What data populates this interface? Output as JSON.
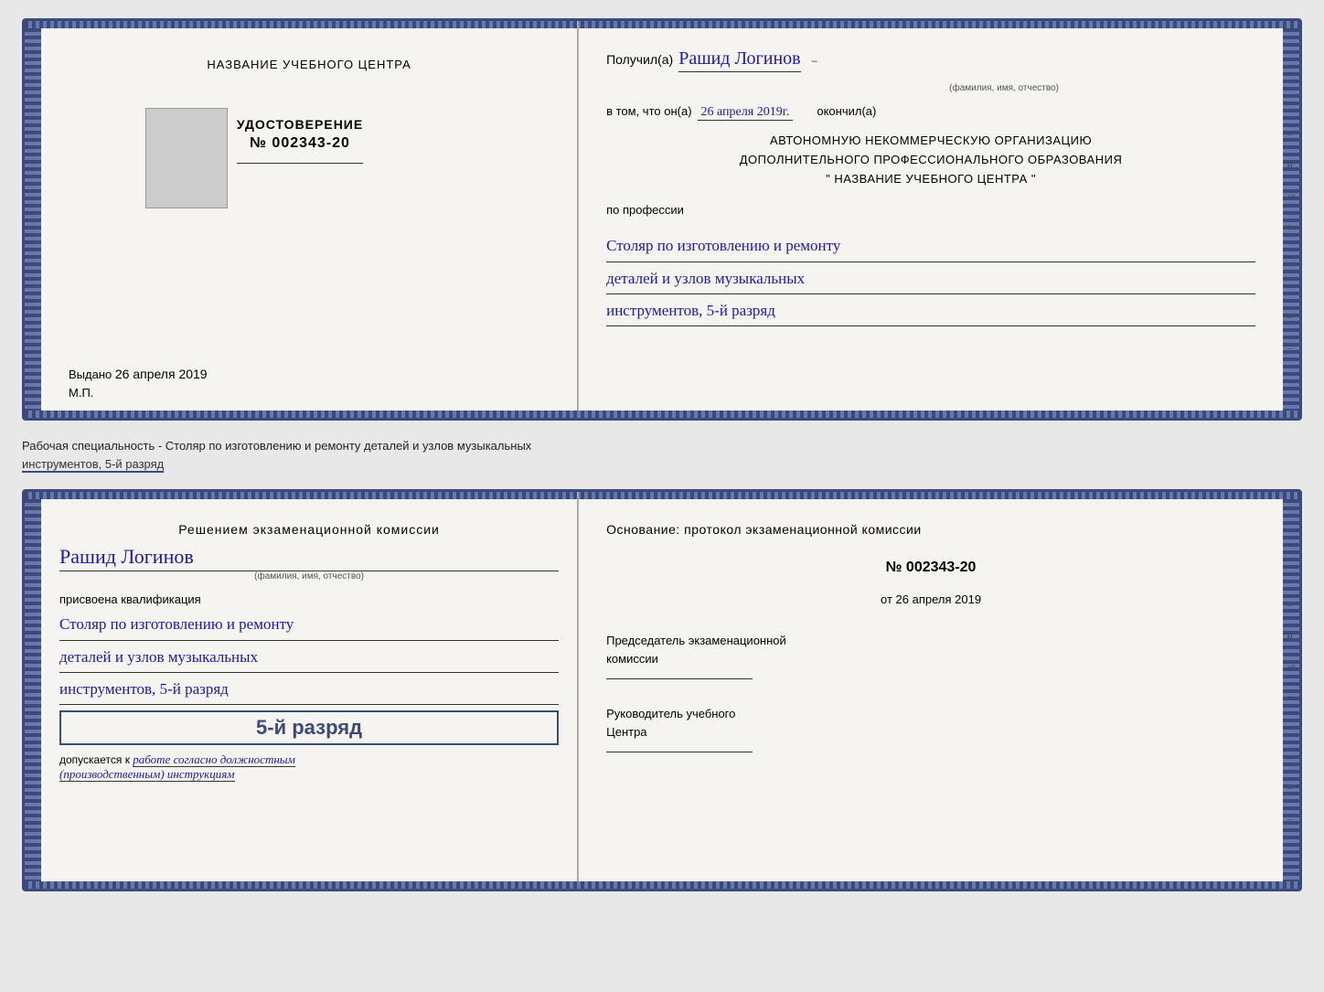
{
  "topDoc": {
    "leftPanel": {
      "centerTitle": "НАЗВАНИЕ УЧЕБНОГО ЦЕНТРА",
      "udostLabel": "УДОСТОВЕРЕНИЕ",
      "udostNum": "№ 002343-20",
      "vydanoLabel": "Выдано",
      "vydanoDate": "26 апреля 2019",
      "mp": "М.П."
    },
    "rightPanel": {
      "poluchilLabel": "Получил(а)",
      "recipientName": "Рашид Логинов",
      "famLabel": "(фамилия, имя, отчество)",
      "vTomChtoLabel": "в том, что он(а)",
      "completionDate": "26 апреля 2019г.",
      "okonchilLabel": "окончил(а)",
      "orgLine1": "АВТОНОМНУЮ НЕКОММЕРЧЕСКУЮ ОРГАНИЗАЦИЮ",
      "orgLine2": "ДОПОЛНИТЕЛЬНОГО ПРОФЕССИОНАЛЬНОГО ОБРАЗОВАНИЯ",
      "orgLine3": "\"  НАЗВАНИЕ УЧЕБНОГО ЦЕНТРА  \"",
      "poProfilessiiLabel": "по профессии",
      "profLine1": "Столяр по изготовлению и ремонту",
      "profLine2": "деталей и узлов музыкальных",
      "profLine3": "инструментов, 5-й разряд"
    }
  },
  "betweenDocs": {
    "text1": "Рабочая специальность - Столяр по изготовлению и ремонту деталей и узлов музыкальных",
    "text2": "инструментов, 5-й разряд"
  },
  "bottomDoc": {
    "leftPanel": {
      "decisionLine1": "Решением  экзаменационной  комиссии",
      "personName": "Рашид Логинов",
      "famLabel": "(фамилия, имя, отчество)",
      "assignedLabel": "присвоена квалификация",
      "qualLine1": "Столяр по изготовлению и ремонту",
      "qualLine2": "деталей и узлов музыкальных",
      "qualLine3": "инструментов, 5-й разряд",
      "razryadText": "5-й разряд",
      "dopuskLabel": "допускается к",
      "dopuskValue": "работе согласно должностным",
      "dopuskValue2": "(производственным) инструкциям"
    },
    "rightPanel": {
      "osnovLabel": "Основание: протокол экзаменационной  комиссии",
      "protoNum": "№  002343-20",
      "protoDatePrefix": "от",
      "protoDate": "26 апреля 2019",
      "predsLabel1": "Председатель экзаменационной",
      "predsLabel2": "комиссии",
      "rukovLabel1": "Руководитель учебного",
      "rukovLabel2": "Центра"
    }
  }
}
